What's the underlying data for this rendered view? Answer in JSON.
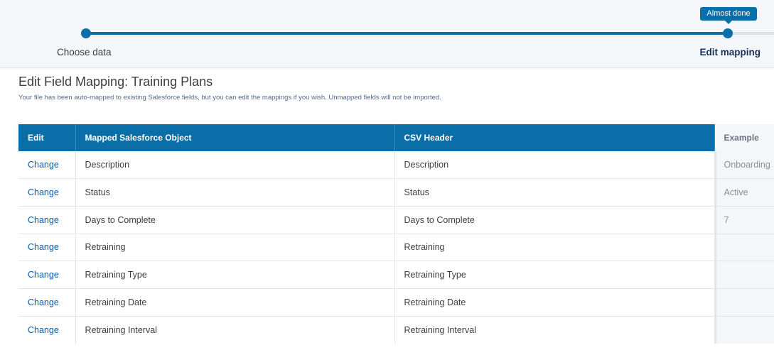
{
  "wizard": {
    "steps": [
      {
        "label": "Choose data",
        "status": "complete"
      },
      {
        "label": "Edit mapping",
        "status": "current"
      }
    ],
    "tooltip": "Almost done",
    "progress_fraction": 0.92
  },
  "page": {
    "title": "Edit Field Mapping: Training Plans",
    "description": "Your file has been auto-mapped to existing Salesforce fields, but you can edit the mappings if you wish. Unmapped fields will not be imported."
  },
  "table": {
    "headers": {
      "edit": "Edit",
      "object": "Mapped Salesforce Object",
      "csv": "CSV Header",
      "example": "Example"
    },
    "rows": [
      {
        "edit": "Change",
        "object": "Description",
        "csv": "Description",
        "example": "Onboarding"
      },
      {
        "edit": "Change",
        "object": "Status",
        "csv": "Status",
        "example": "Active"
      },
      {
        "edit": "Change",
        "object": "Days to Complete",
        "csv": "Days to Complete",
        "example": "7"
      },
      {
        "edit": "Change",
        "object": "Retraining",
        "csv": "Retraining",
        "example": ""
      },
      {
        "edit": "Change",
        "object": "Retraining Type",
        "csv": "Retraining Type",
        "example": ""
      },
      {
        "edit": "Change",
        "object": "Retraining Date",
        "csv": "Retraining Date",
        "example": ""
      },
      {
        "edit": "Change",
        "object": "Retraining Interval",
        "csv": "Retraining Interval",
        "example": ""
      }
    ]
  },
  "colors": {
    "accent": "#0a6ea8",
    "link": "#0b5cab",
    "panel": "#f4f6f9"
  }
}
